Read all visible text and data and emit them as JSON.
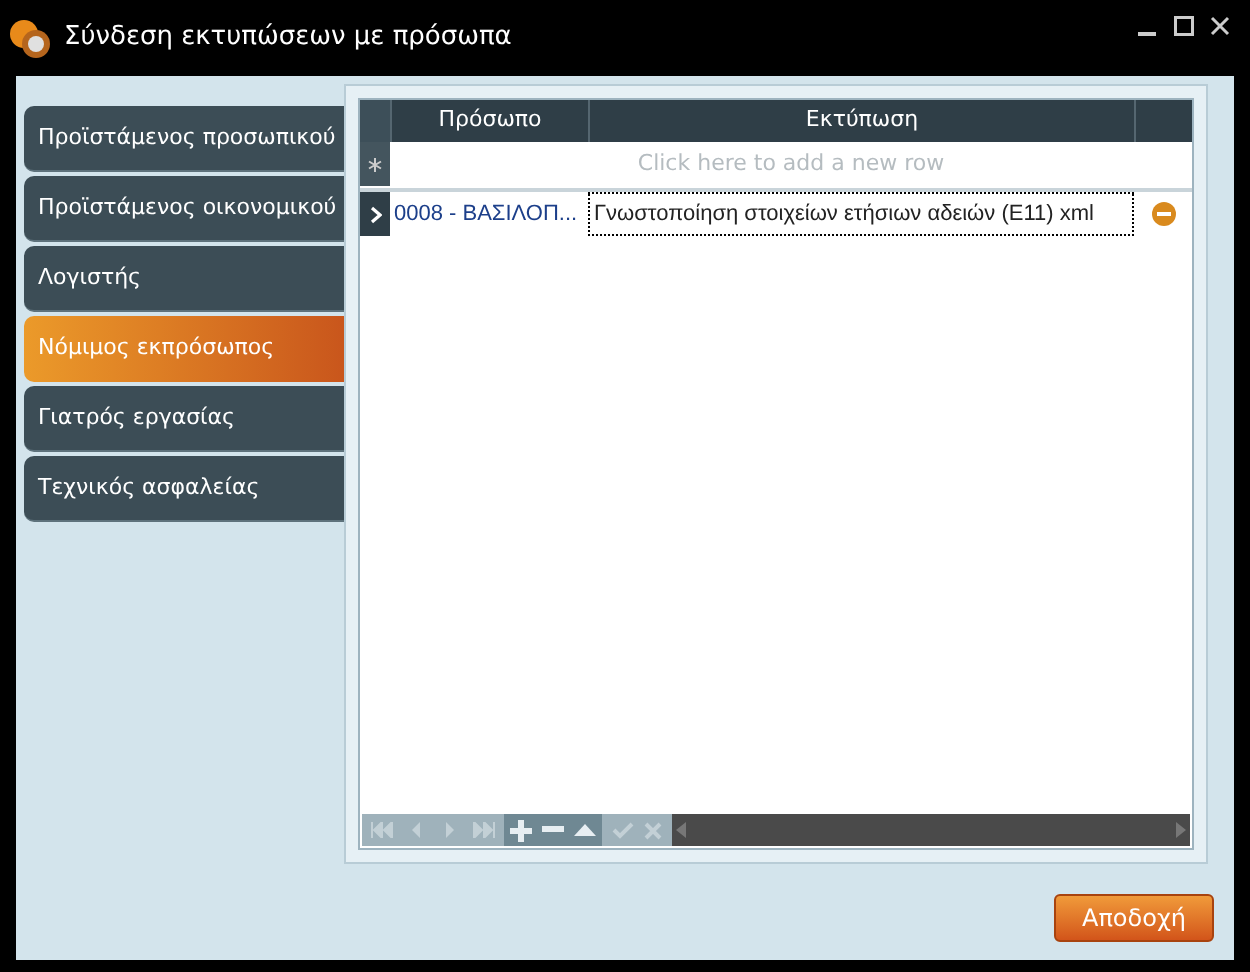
{
  "window": {
    "title": "Σύνδεση εκτυπώσεων με πρόσωπα"
  },
  "tabs": [
    {
      "label": "Προϊστάμενος προσωπικού",
      "selected": false
    },
    {
      "label": "Προϊστάμενος οικονομικού",
      "selected": false
    },
    {
      "label": "Λογιστής",
      "selected": false
    },
    {
      "label": "Νόμιμος εκπρόσωπος",
      "selected": true
    },
    {
      "label": "Γιατρός εργασίας",
      "selected": false
    },
    {
      "label": "Τεχνικός ασφαλείας",
      "selected": false
    }
  ],
  "table": {
    "columns": [
      "Πρόσωπο",
      "Εκτύπωση"
    ],
    "new_row_placeholder": "Click here to add a new row",
    "rows": [
      {
        "cells": [
          "0008 - ΒΑΣΙΛΟΠ...",
          "Γνωστοποίηση στοιχείων ετήσιων αδειών (Ε11) xml"
        ],
        "current": true
      }
    ]
  },
  "buttons": [
    "Αποδοχή"
  ]
}
